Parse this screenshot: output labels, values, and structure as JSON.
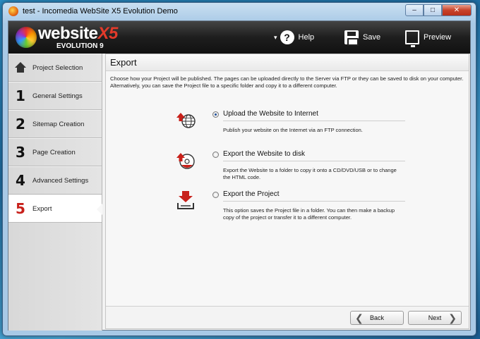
{
  "window": {
    "title": "test - Incomedia WebSite X5 Evolution Demo",
    "controls": {
      "minimize": "–",
      "maximize": "□",
      "close": "✕"
    }
  },
  "logo": {
    "main": "website",
    "accent": "X5",
    "sub": "EVOLUTION 9"
  },
  "toolbar": {
    "help": "Help",
    "save": "Save",
    "preview": "Preview",
    "dropdown_glyph": "▾"
  },
  "sidebar": {
    "items": [
      {
        "number": "",
        "label": "Project Selection",
        "icon": "home-icon"
      },
      {
        "number": "1",
        "label": "General Settings"
      },
      {
        "number": "2",
        "label": "Sitemap Creation"
      },
      {
        "number": "3",
        "label": "Page Creation"
      },
      {
        "number": "4",
        "label": "Advanced Settings"
      },
      {
        "number": "5",
        "label": "Export",
        "active": true
      }
    ]
  },
  "main": {
    "title": "Export",
    "intro": "Choose how your Project will be published. The pages can be uploaded directly to the Server via FTP or they can be saved to disk on your computer. Alternatively, you can save the Project file to a specific folder and copy it to a different computer.",
    "options": [
      {
        "title": "Upload the Website to Internet",
        "desc": "Publish your website on the Internet via an FTP connection.",
        "checked": true,
        "icon": "globe-upload-icon"
      },
      {
        "title": "Export the Website to disk",
        "desc": "Export the Website to a folder to copy it onto a CD/DVD/USB or to change the HTML code.",
        "checked": false,
        "icon": "disk-export-icon"
      },
      {
        "title": "Export the Project",
        "desc": "This option saves the Project file in a folder.  You can then make a backup copy of the project or transfer it to a different computer.",
        "checked": false,
        "icon": "project-download-icon"
      }
    ]
  },
  "footer": {
    "back": "Back",
    "next": "Next",
    "back_glyph": "❮",
    "next_glyph": "❯"
  },
  "colors": {
    "accent_red": "#c8201a",
    "topbar_dark": "#1e1e1e"
  }
}
